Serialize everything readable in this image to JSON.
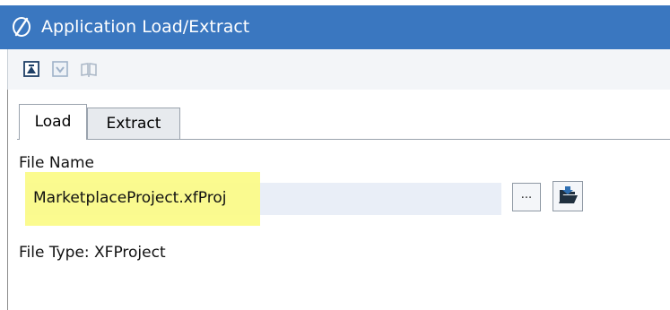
{
  "window": {
    "title": "Application Load/Extract",
    "logo_icon": "onestream-logo-icon"
  },
  "toolbar": {
    "buttons": [
      {
        "icon": "load-icon",
        "enabled": true
      },
      {
        "icon": "extract-icon",
        "enabled": false
      },
      {
        "icon": "unknown-book-icon",
        "enabled": false
      }
    ]
  },
  "tabs": [
    {
      "label": "Load",
      "active": true
    },
    {
      "label": "Extract",
      "active": false
    }
  ],
  "form": {
    "file_name_label": "File Name",
    "file_name_value": "MarketplaceProject.xfProj",
    "browse_label": "...",
    "open_icon": "open-folder-icon",
    "file_type_text": "File Type: XFProject"
  },
  "colors": {
    "titlebar": "#3a77c0",
    "highlight": "#fbfb86"
  }
}
